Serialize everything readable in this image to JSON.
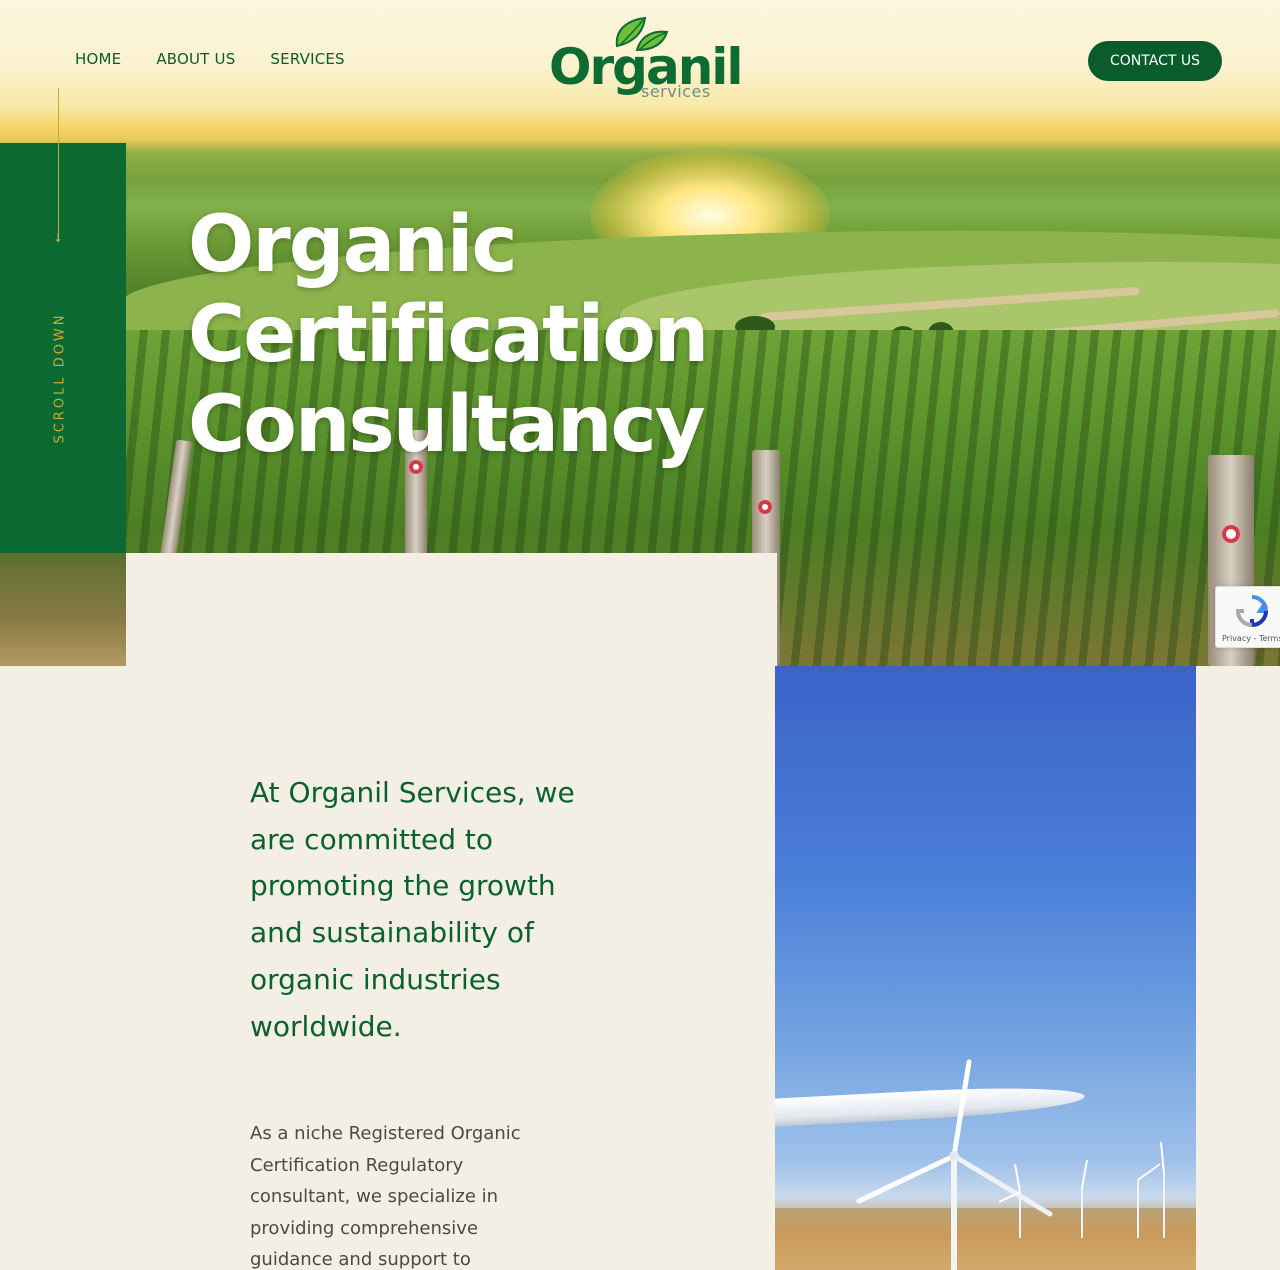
{
  "nav": {
    "home": "HOME",
    "about": "ABOUT US",
    "services": "SERVICES",
    "contact": "CONTACT US"
  },
  "logo": {
    "word": "Organil",
    "sub": "services"
  },
  "side": {
    "scroll": "SCROLL DOWN"
  },
  "hero": {
    "line1": "Organic",
    "line2": "Certification",
    "line3": "Consultancy"
  },
  "recaptcha": {
    "text": "Privacy - Terms"
  },
  "content": {
    "lead": "At Organil Services, we are committed to promoting the growth and sustainability of organic industries worldwide.",
    "body": "As a niche Registered Organic Certification Regulatory consultant, we specialize in providing comprehensive guidance and support to"
  },
  "colors": {
    "brand_green": "#0a6a31",
    "accent_gold": "#c7a93a",
    "cream": "#f4efe4"
  }
}
